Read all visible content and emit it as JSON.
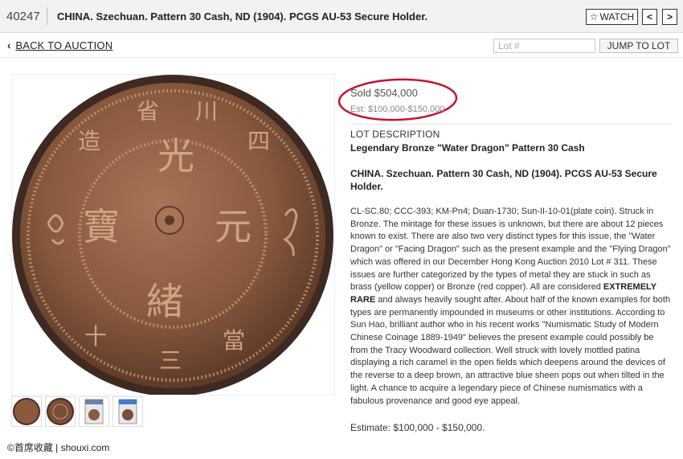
{
  "header": {
    "lot_number": "40247",
    "title": "CHINA. Szechuan. Pattern 30 Cash, ND (1904). PCGS AU-53 Secure Holder.",
    "watch_label": "WATCH",
    "watch_icon": "star-outline-icon",
    "prev_icon": "chevron-left-icon",
    "next_icon": "chevron-right-icon"
  },
  "subnav": {
    "back_label": "BACK TO AUCTION",
    "lot_placeholder": "Lot #",
    "jump_label": "JUMP TO LOT"
  },
  "price": {
    "sold": "Sold $504,000",
    "estimate": "Est: $100,000-$150,000",
    "highlight_color": "#c8102e"
  },
  "description": {
    "heading": "LOT DESCRIPTION",
    "subtitle": "Legendary Bronze \"Water Dragon\" Pattern 30 Cash",
    "title": "CHINA. Szechuan. Pattern 30 Cash, ND (1904). PCGS AU-53 Secure Holder.",
    "body_1": "CL-SC.80; CCC-393; KM-Pn4; Duan-1730; Sun-II-10-01(plate coin). Struck in Bronze. The mintage for these issues is unknown, but there are about 12 pieces known to exist. There are also two very distinct types for this issue, the \"Water Dragon\" or \"Facing Dragon\" such as the present example and the \"Flying Dragon\" which was offered in our December Hong Kong Auction 2010 Lot # 311. These issues are further categorized by the types of metal they are stuck in such as brass (yellow copper) or Bronze (red copper). All are considered ",
    "body_strong": "EXTREMELY RARE",
    "body_2": " and always heavily sought after. About half of the known examples for both types are permanently impounded in museums or other institutions. According to Sun Hao, brilliant author who in his recent works \"Numismatic Study of Modern Chinese Coinage 1889-1949\" believes the present example could possibly be from the Tracy Woodward collection. Well struck with lovely mottled patina displaying a rich caramel in the open fields which deepens around the devices of the reverse to a deep brown, an attractive blue sheen pops out when tilted in the light. A chance to acquire a legendary piece of Chinese numismatics with a fabulous provenance and good eye appeal.",
    "estimate": "Estimate: $100,000 - $150,000."
  },
  "coin": {
    "top_chars": [
      "造",
      "省",
      "川",
      "四"
    ],
    "center_chars": [
      "光",
      "寶",
      "元",
      "緒"
    ],
    "bottom_chars": [
      "十",
      "三",
      "當"
    ],
    "metal_color": "#8a5a3e"
  },
  "thumbnails": [
    {
      "name": "thumb-obverse"
    },
    {
      "name": "thumb-reverse"
    },
    {
      "name": "thumb-slab-front"
    },
    {
      "name": "thumb-slab-back"
    }
  ],
  "watermark": "©首席收藏 | shouxi.com"
}
